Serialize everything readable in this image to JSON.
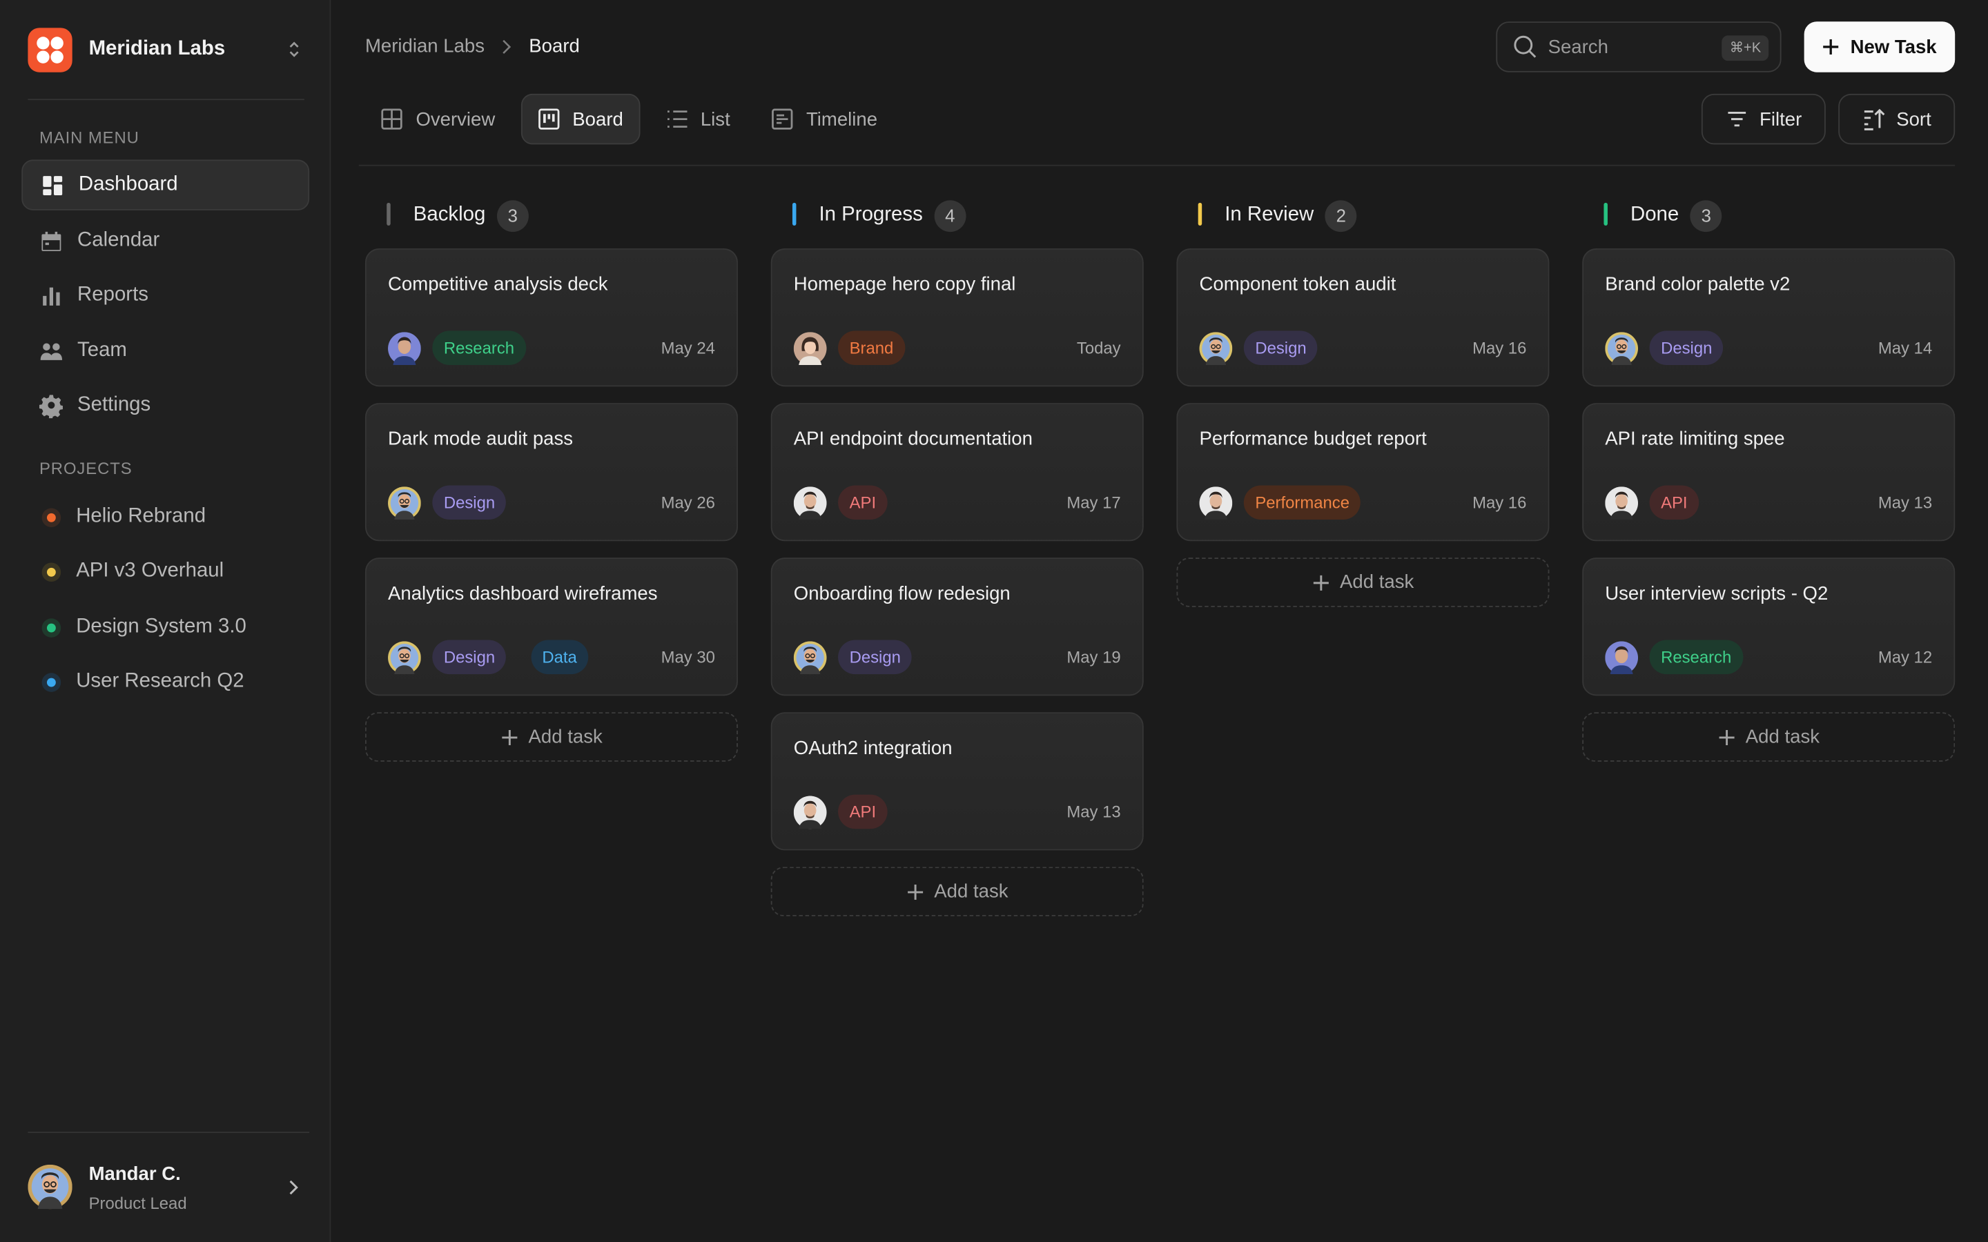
{
  "workspace": {
    "name": "Meridian Labs"
  },
  "sidebar": {
    "main_menu_label": "MAIN MENU",
    "items": [
      {
        "label": "Dashboard",
        "icon": "dashboard-icon",
        "active": true
      },
      {
        "label": "Calendar",
        "icon": "calendar-icon"
      },
      {
        "label": "Reports",
        "icon": "bar-chart-icon"
      },
      {
        "label": "Team",
        "icon": "team-icon"
      },
      {
        "label": "Settings",
        "icon": "gear-icon"
      }
    ],
    "projects_label": "PROJECTS",
    "projects": [
      {
        "label": "Helio Rebrand",
        "color": "#f26a2e"
      },
      {
        "label": "API v3 Overhaul",
        "color": "#f2c94c"
      },
      {
        "label": "Design System 3.0",
        "color": "#27c281"
      },
      {
        "label": "User Research Q2",
        "color": "#3aa8f0"
      }
    ]
  },
  "user": {
    "name": "Mandar C.",
    "role": "Product Lead"
  },
  "breadcrumb": {
    "parent": "Meridian Labs",
    "current": "Board"
  },
  "search": {
    "placeholder": "Search",
    "shortcut": "⌘+K"
  },
  "toolbar": {
    "new_task": "New Task",
    "filter": "Filter",
    "sort": "Sort"
  },
  "view_tabs": [
    {
      "label": "Overview",
      "icon": "grid-icon"
    },
    {
      "label": "Board",
      "icon": "board-icon",
      "active": true
    },
    {
      "label": "List",
      "icon": "list-icon"
    },
    {
      "label": "Timeline",
      "icon": "timeline-icon"
    }
  ],
  "tag_colors": {
    "Research": {
      "bg": "#1d3b2d",
      "fg": "#3fd08a"
    },
    "Design": {
      "bg": "#343046",
      "fg": "#a99cf2"
    },
    "Data": {
      "bg": "#1d3446",
      "fg": "#4fb3f0"
    },
    "Brand": {
      "bg": "#4a2a1d",
      "fg": "#f27a42"
    },
    "API": {
      "bg": "#442828",
      "fg": "#f07a7a"
    },
    "Performance": {
      "bg": "#4a2b1c",
      "fg": "#f08545"
    }
  },
  "columns": [
    {
      "title": "Backlog",
      "count": "3",
      "color": "#666666",
      "cards": [
        {
          "title": "Competitive analysis deck",
          "tags": [
            "Research"
          ],
          "date": "May 24",
          "avatar": "avatar-blue"
        },
        {
          "title": "Dark mode audit pass",
          "tags": [
            "Design"
          ],
          "date": "May 26",
          "avatar": "avatar-glasses"
        },
        {
          "title": "Analytics dashboard wireframes",
          "tags": [
            "Design",
            "Data"
          ],
          "date": "May 30",
          "avatar": "avatar-glasses"
        }
      ],
      "add_label": "Add task"
    },
    {
      "title": "In Progress",
      "count": "4",
      "color": "#3aa8f0",
      "cards": [
        {
          "title": "Homepage hero copy final",
          "tags": [
            "Brand"
          ],
          "date": "Today",
          "avatar": "avatar-woman"
        },
        {
          "title": "API endpoint documentation",
          "tags": [
            "API"
          ],
          "date": "May 17",
          "avatar": "avatar-man"
        },
        {
          "title": "Onboarding flow redesign",
          "tags": [
            "Design"
          ],
          "date": "May 19",
          "avatar": "avatar-glasses"
        },
        {
          "title": "OAuth2 integration",
          "tags": [
            "API"
          ],
          "date": "May 13",
          "avatar": "avatar-man"
        }
      ],
      "add_label": "Add task"
    },
    {
      "title": "In Review",
      "count": "2",
      "color": "#f2c94c",
      "cards": [
        {
          "title": "Component token audit",
          "tags": [
            "Design"
          ],
          "date": "May 16",
          "avatar": "avatar-glasses"
        },
        {
          "title": "Performance budget report",
          "tags": [
            "Performance"
          ],
          "date": "May 16",
          "avatar": "avatar-man"
        }
      ],
      "add_label": "Add task"
    },
    {
      "title": "Done",
      "count": "3",
      "color": "#27c281",
      "cards": [
        {
          "title": "Brand color palette v2",
          "tags": [
            "Design"
          ],
          "date": "May 14",
          "avatar": "avatar-glasses"
        },
        {
          "title": "API rate limiting spee",
          "tags": [
            "API"
          ],
          "date": "May 13",
          "avatar": "avatar-man"
        },
        {
          "title": "User interview scripts - Q2",
          "tags": [
            "Research"
          ],
          "date": "May 12",
          "avatar": "avatar-blue"
        }
      ],
      "add_label": "Add task"
    }
  ]
}
